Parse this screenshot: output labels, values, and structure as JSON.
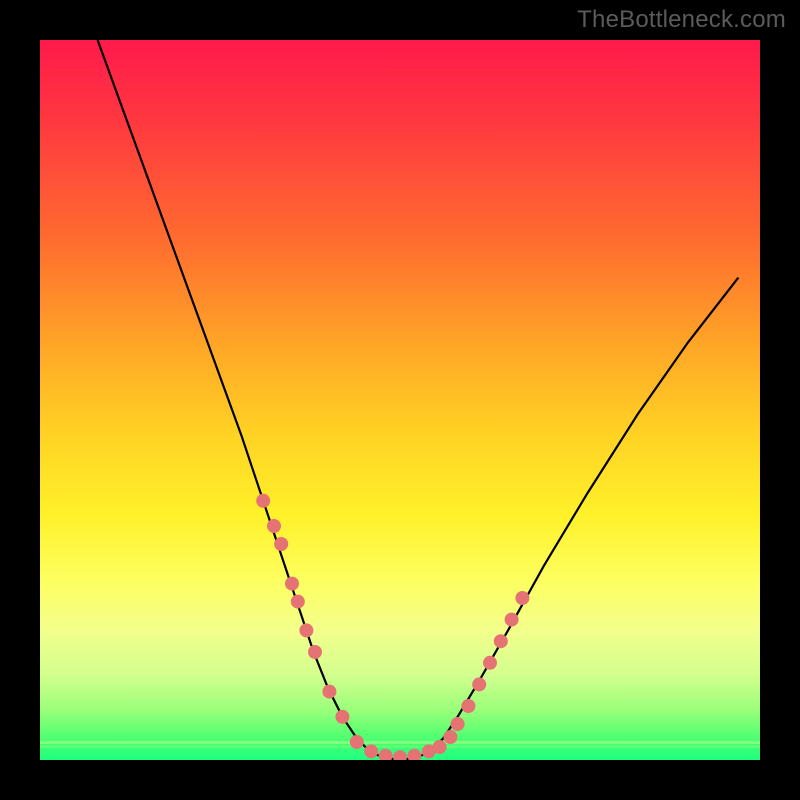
{
  "watermark": "TheBottleneck.com",
  "colors": {
    "dot": "#e57373",
    "curve": "#000000",
    "gradient_top": "#ff1a4b",
    "gradient_bottom": "#20ff80"
  },
  "chart_data": {
    "type": "line",
    "title": "",
    "xlabel": "",
    "ylabel": "",
    "xlim": [
      0,
      100
    ],
    "ylim": [
      0,
      100
    ],
    "series": [
      {
        "name": "bottleneck-curve",
        "x": [
          8,
          12,
          16,
          20,
          24,
          28,
          31,
          34,
          36,
          38,
          40,
          42,
          44,
          46,
          48,
          50,
          52,
          54,
          56,
          58,
          61,
          65,
          70,
          76,
          83,
          90,
          97
        ],
        "y": [
          100,
          89,
          78,
          67,
          56,
          45,
          36,
          27,
          21,
          15,
          10,
          6,
          3,
          1,
          0.3,
          0,
          0.3,
          1,
          3,
          6,
          11,
          18,
          27,
          37,
          48,
          58,
          67
        ]
      }
    ],
    "highlight_points": {
      "name": "dots",
      "left_cluster_x": [
        31,
        32.5,
        33.5,
        35,
        35.8,
        37,
        38.2,
        40.2,
        42
      ],
      "left_cluster_y": [
        36,
        32.5,
        30,
        24.5,
        22,
        18,
        15,
        9.5,
        6
      ],
      "flat_cluster_x": [
        44,
        46,
        48,
        50,
        52,
        54,
        55.5
      ],
      "flat_cluster_y": [
        2.5,
        1.2,
        0.6,
        0.4,
        0.6,
        1.2,
        1.8
      ],
      "right_cluster_x": [
        57,
        58,
        59.5,
        61,
        62.5,
        64,
        65.5,
        67
      ],
      "right_cluster_y": [
        3.2,
        5,
        7.5,
        10.5,
        13.5,
        16.5,
        19.5,
        22.5
      ]
    }
  }
}
